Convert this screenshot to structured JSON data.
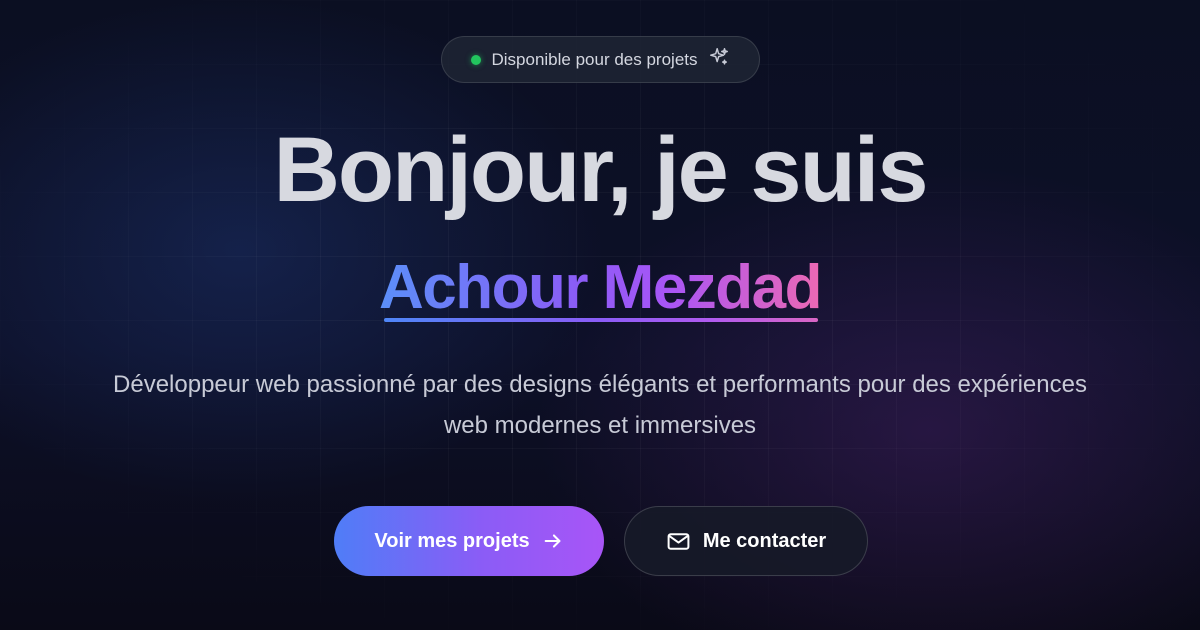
{
  "badge": {
    "status_color": "#22c55e",
    "text": "Disponible pour des projets",
    "icon": "sparkle-icon"
  },
  "hero": {
    "headline": "Bonjour, je suis",
    "name": "Achour Mezdad",
    "tagline": "Développeur web passionné par des designs élégants et performants pour des expériences web modernes et immersives"
  },
  "buttons": {
    "primary": {
      "label": "Voir mes projets",
      "icon": "arrow-right-icon"
    },
    "secondary": {
      "label": "Me contacter",
      "icon": "mail-icon"
    }
  },
  "colors": {
    "accent_blue": "#5b8ff9",
    "accent_purple": "#a855f7",
    "accent_pink": "#ec69b3"
  }
}
